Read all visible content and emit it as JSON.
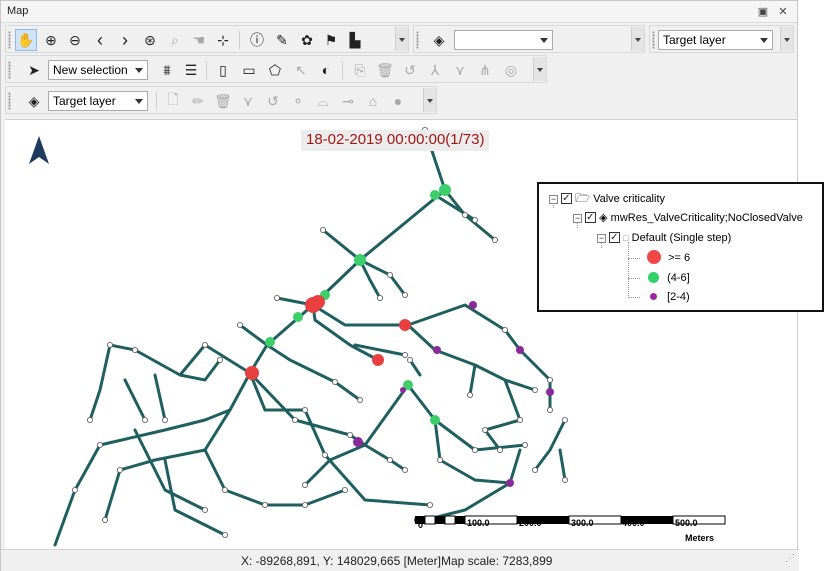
{
  "window": {
    "title": "Map",
    "restore_glyph": "▣",
    "close_glyph": "✕"
  },
  "toolbar1": {
    "buttons": [
      "pan-hand-icon",
      "zoom-in-icon",
      "zoom-out-icon",
      "previous-extent-icon",
      "next-extent-icon",
      "full-extent-globe-icon",
      "zoom-to-selection-icon",
      "pan-to-selection-icon",
      "clear-selection-icon",
      "identify-info-icon",
      "edit-attributes-icon",
      "network-tools-icon",
      "flag-icon",
      "profile-chart-icon"
    ],
    "layer_combo_value": "",
    "target_layer_combo_value": "Target layer"
  },
  "toolbar2": {
    "selection_combo_value": "New selection",
    "buttons": [
      "select-arrow-icon",
      "filter-selection-icon",
      "list-icon",
      "select-by-shape-icon",
      "rectangle-icon",
      "circle-icon",
      "polygon-icon",
      "clear-select-icon",
      "contrast-icon",
      "add-icon",
      "delete-icon",
      "undo-icon",
      "split-icon",
      "merge-icon",
      "nodes-icon",
      "capture-icon"
    ]
  },
  "toolbar3": {
    "target_layer_combo_value": "Target layer",
    "buttons": [
      "layer-stack-icon",
      "new-feature-icon",
      "edit-pencil-icon",
      "delete-feature-icon",
      "reshape-icon",
      "undo-edit-icon",
      "vertex-icon",
      "arc-icon",
      "link-icon",
      "snapshot-icon",
      "points-icon"
    ]
  },
  "map": {
    "timestamp": "18-02-2019 00:00:00(1/73)",
    "north_arrow": "north-arrow-icon",
    "pipe_color": "#1f5f5f",
    "colors": {
      "high": "#e84040",
      "mid": "#3ccf6a",
      "low": "#8a2a9a",
      "node": "#ffffff"
    },
    "scalebar": {
      "labels": [
        "0",
        "100.0",
        "200.0",
        "300.0",
        "400.0",
        "500.0"
      ],
      "unit": "Meters"
    }
  },
  "legend": {
    "group": "Valve criticality",
    "layer": "mwRes_ValveCriticality;NoClosedValve",
    "theme": "Default (Single step)",
    "classes": [
      {
        "label": ">= 6",
        "color": "#f04848",
        "size": "large"
      },
      {
        "label": "(4-6]",
        "color": "#33d06a",
        "size": "medium"
      },
      {
        "label": "[2-4)",
        "color": "#9a2a9c",
        "size": "small"
      }
    ]
  },
  "status": {
    "coordinates": "X: -89268,891, Y: 148029,665 [Meter]",
    "map_scale": "Map scale: 7283,899"
  }
}
